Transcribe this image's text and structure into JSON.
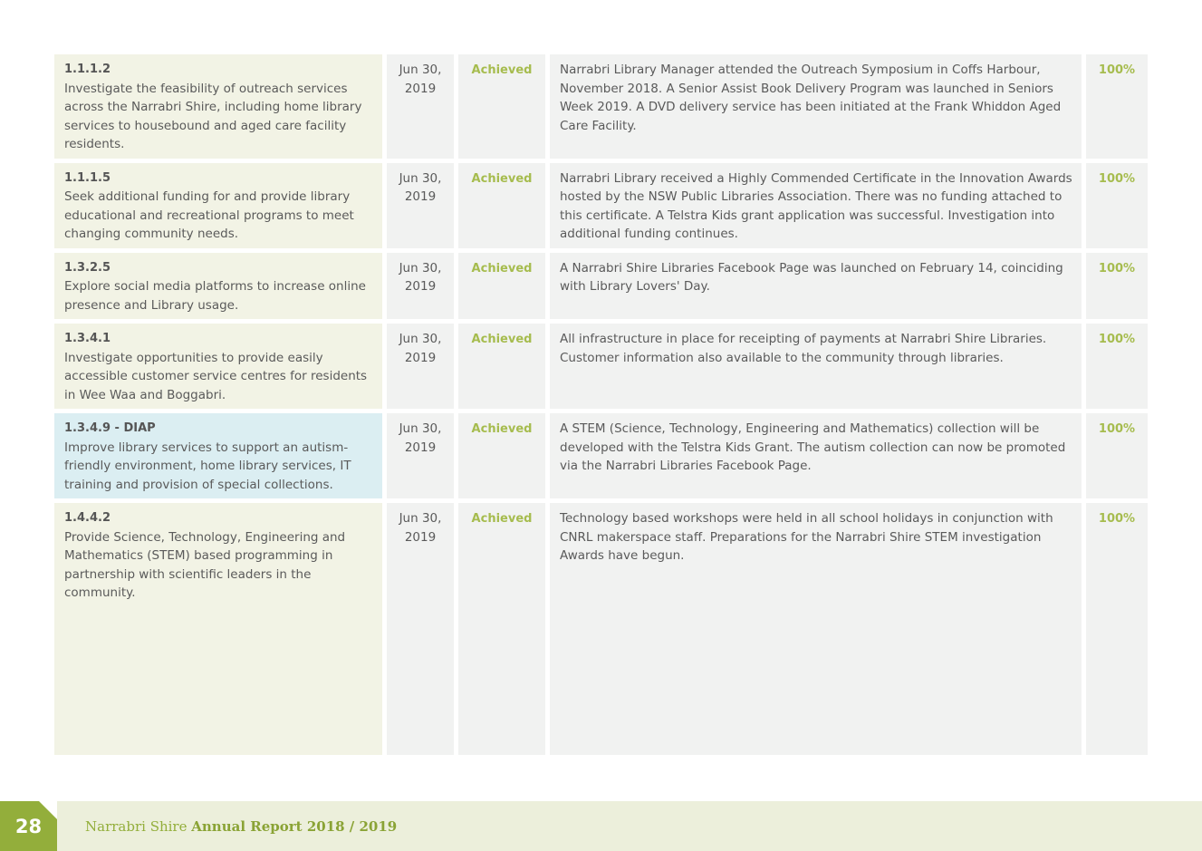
{
  "rows": [
    {
      "code": "1.1.1.2",
      "description": "Investigate the feasibility of outreach services across the Narrabri Shire, including home library services to housebound and aged care facility residents.",
      "date": "Jun 30, 2019",
      "status": "Achieved",
      "comment": "Narrabri Library Manager attended the Outreach Symposium in Coffs Harbour, November 2018. A Senior Assist Book Delivery Program was launched in Seniors Week 2019. A DVD delivery service has been initiated at the Frank Whiddon Aged Care Facility.",
      "progress": "100%"
    },
    {
      "code": "1.1.1.5",
      "description": "Seek additional funding for and provide library educational and recreational programs to meet changing community needs.",
      "date": "Jun 30, 2019",
      "status": "Achieved",
      "comment": "Narrabri Library received a Highly Commended Certificate in the Innovation Awards hosted by the NSW Public Libraries Association. There was no funding attached to this certificate. A Telstra Kids grant application was successful. Investigation into additional funding continues.",
      "progress": "100%"
    },
    {
      "code": "1.3.2.5",
      "description": "Explore social media platforms to increase online presence and Library usage.",
      "date": "Jun 30, 2019",
      "status": "Achieved",
      "comment": "A Narrabri Shire Libraries Facebook Page was launched on February 14, coinciding with Library Lovers' Day.",
      "progress": "100%"
    },
    {
      "code": "1.3.4.1",
      "description": "Investigate opportunities to provide easily accessible customer service centres for residents in Wee Waa and Boggabri.",
      "date": "Jun 30, 2019",
      "status": "Achieved",
      "comment": "All infrastructure in place for receipting of payments at Narrabri Shire Libraries. Customer information also available to the community through libraries.",
      "progress": "100%"
    },
    {
      "code": "1.3.4.9 - DIAP",
      "description": "Improve library services to support an autism-friendly environment, home library services, IT training and provision of special collections.",
      "date": "Jun 30, 2019",
      "status": "Achieved",
      "comment": "A STEM (Science, Technology, Engineering and Mathematics) collection will be developed with the Telstra Kids Grant. The autism collection can now be promoted via the Narrabri Libraries Facebook Page.",
      "progress": "100%"
    },
    {
      "code": "1.4.4.2",
      "description": "Provide Science, Technology, Engineering and Mathematics (STEM) based programming in partnership with scientific leaders in the community.",
      "date": "Jun 30, 2019",
      "status": "Achieved",
      "comment": "Technology based workshops were held in all school holidays in conjunction with CNRL makerspace staff. Preparations for the Narrabri Shire STEM investigation Awards have begun.",
      "progress": "100%"
    }
  ],
  "footer": {
    "page_number": "28",
    "shire": "Narrabri Shire",
    "report_title": "Annual Report 2018 / 2019"
  },
  "colors": {
    "accent_green": "#93ae3b",
    "status_green": "#a6bc4e",
    "action_cell_bg": "#f2f3e5",
    "diap_cell_bg": "#dbeef2",
    "cell_bg": "#f1f2f1",
    "footer_bg": "#ecefdb"
  }
}
